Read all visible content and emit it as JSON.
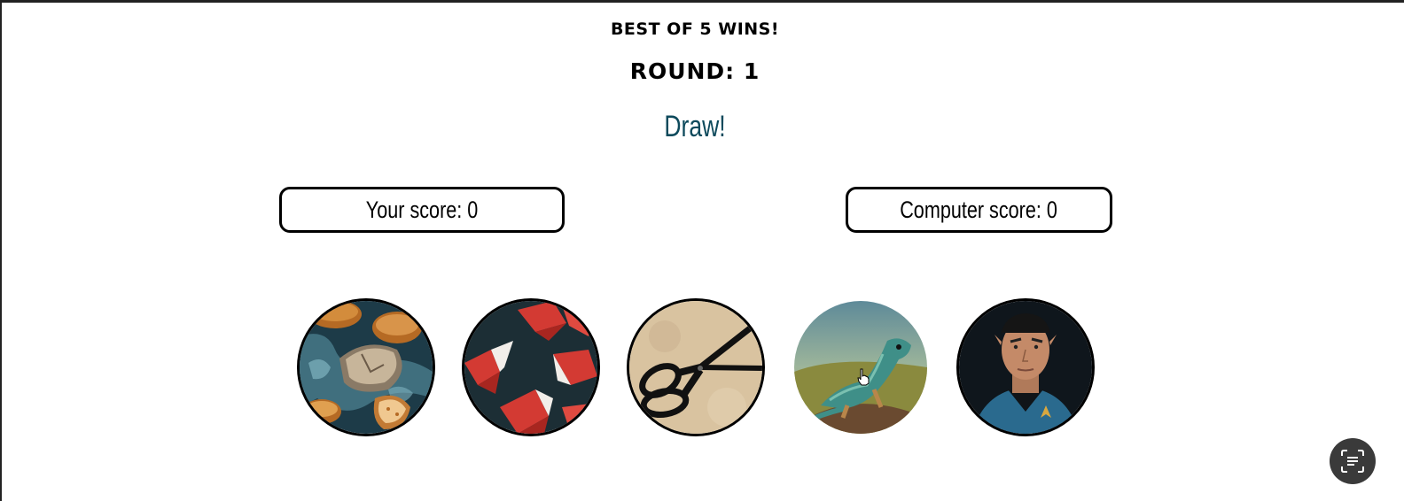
{
  "game": {
    "subtitle": "BEST OF 5 WINS!",
    "round_label": "ROUND: 1",
    "result": "Draw!",
    "player_score": "Your score: 0",
    "computer_score": "Computer score: 0"
  },
  "choices": [
    {
      "id": "rock",
      "icon": "rock-icon"
    },
    {
      "id": "paper",
      "icon": "paper-icon"
    },
    {
      "id": "scissors",
      "icon": "scissors-icon"
    },
    {
      "id": "lizard",
      "icon": "lizard-icon"
    },
    {
      "id": "spock",
      "icon": "spock-icon"
    }
  ],
  "floating_button": {
    "icon": "text-scan-icon"
  },
  "colors": {
    "accent": "#0e4a5c",
    "text": "#000000",
    "fab_background": "#3a3a3a"
  }
}
